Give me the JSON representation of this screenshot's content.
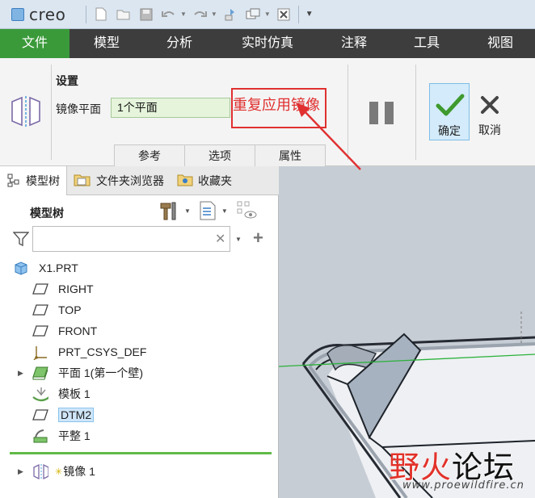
{
  "app": {
    "logo_text": "creo"
  },
  "menu": {
    "tabs": [
      {
        "label": "文件",
        "active": true
      },
      {
        "label": "模型"
      },
      {
        "label": "分析"
      },
      {
        "label": "实时仿真"
      },
      {
        "label": "注释"
      },
      {
        "label": "工具"
      },
      {
        "label": "视图"
      }
    ]
  },
  "ribbon": {
    "settings_title": "设置",
    "mirror_plane_label": "镜像平面",
    "mirror_plane_value": "1个平面",
    "subtabs": [
      "参考",
      "选项",
      "属性"
    ],
    "ok_label": "确定",
    "cancel_label": "取消"
  },
  "annotation": {
    "text": "重复应用镜像",
    "color": "#e03030"
  },
  "panel": {
    "tabs": [
      "模型树",
      "文件夹浏览器",
      "收藏夹"
    ],
    "tree_header": "模型树",
    "search_placeholder": ""
  },
  "tree": {
    "root": "X1.PRT",
    "items": [
      {
        "label": "RIGHT",
        "icon": "datum-plane-icon"
      },
      {
        "label": "TOP",
        "icon": "datum-plane-icon"
      },
      {
        "label": "FRONT",
        "icon": "datum-plane-icon"
      },
      {
        "label": "PRT_CSYS_DEF",
        "icon": "csys-icon"
      },
      {
        "label": "平面 1(第一个壁)",
        "icon": "flat-wall-icon",
        "expandable": true
      },
      {
        "label": "模板 1",
        "icon": "form-icon"
      },
      {
        "label": "DTM2",
        "icon": "datum-plane-icon",
        "selected": true
      },
      {
        "label": "平整 1",
        "icon": "flatten-icon"
      }
    ],
    "insert_item": {
      "label": "镜像 1",
      "icon": "mirror-icon",
      "expandable": true
    }
  },
  "watermark": {
    "main_left": "野火",
    "main_right": "论坛",
    "url": "www.proewildfire.cn"
  },
  "colors": {
    "menu_bg": "#3d3d3d",
    "active_tab": "#3a9a3a",
    "ok_bg": "#d3ebfa",
    "field_bg": "#e5f4db"
  }
}
